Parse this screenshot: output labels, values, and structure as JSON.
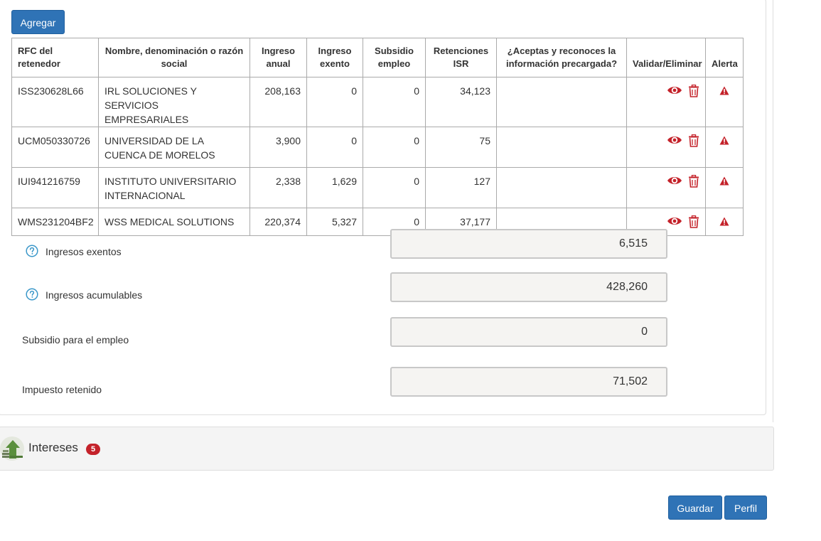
{
  "toolbar": {
    "add_label": "Agregar"
  },
  "table": {
    "headers": {
      "rfc": "RFC del retenedor",
      "nombre": "Nombre, denominación o razón social",
      "ingreso_anual": "Ingreso anual",
      "ingreso_exento": "Ingreso exento",
      "subsidio": "Subsidio empleo",
      "retenciones": "Retenciones ISR",
      "acepta": "¿Aceptas y reconoces la información precargada?",
      "validar": "Validar/Eliminar",
      "alerta": "Alerta"
    },
    "rows": [
      {
        "rfc": "ISS230628L66",
        "nombre": "IRL SOLUCIONES Y SERVICIOS EMPRESARIALES",
        "ingreso_anual": "208,163",
        "ingreso_exento": "0",
        "subsidio": "0",
        "retenciones": "34,123",
        "acepta": ""
      },
      {
        "rfc": "UCM050330726",
        "nombre": "UNIVERSIDAD DE LA CUENCA DE MORELOS",
        "ingreso_anual": "3,900",
        "ingreso_exento": "0",
        "subsidio": "0",
        "retenciones": "75",
        "acepta": ""
      },
      {
        "rfc": "IUI941216759",
        "nombre": "INSTITUTO UNIVERSITARIO INTERNACIONAL",
        "ingreso_anual": "2,338",
        "ingreso_exento": "1,629",
        "subsidio": "0",
        "retenciones": "127",
        "acepta": ""
      },
      {
        "rfc": "WMS231204BF2",
        "nombre": "WSS MEDICAL SOLUTIONS",
        "ingreso_anual": "220,374",
        "ingreso_exento": "5,327",
        "subsidio": "0",
        "retenciones": "37,177",
        "acepta": ""
      }
    ]
  },
  "summary": {
    "ingresos_exentos": {
      "label": "Ingresos exentos",
      "value": "6,515"
    },
    "ingresos_acumulables": {
      "label": "Ingresos acumulables",
      "value": "428,260"
    },
    "subsidio_empleo": {
      "label": "Subsidio para el empleo",
      "value": "0"
    },
    "impuesto_retenido": {
      "label": "Impuesto retenido",
      "value": "71,502"
    }
  },
  "intereses": {
    "title": "Intereses",
    "count": "5"
  },
  "footer": {
    "save_label": "Guardar",
    "profile_label": "Perfil"
  },
  "colors": {
    "primary_button": "#2f73b6",
    "action_icon": "#c4222a",
    "badge": "#c4222a",
    "help_icon": "#3a97c9",
    "interest_icon": "#5a8f3c"
  },
  "icons": {
    "view": "eye-icon",
    "delete": "trash-icon",
    "alert": "warning-icon",
    "help": "help-circle-icon",
    "section": "interest-growth-icon"
  }
}
